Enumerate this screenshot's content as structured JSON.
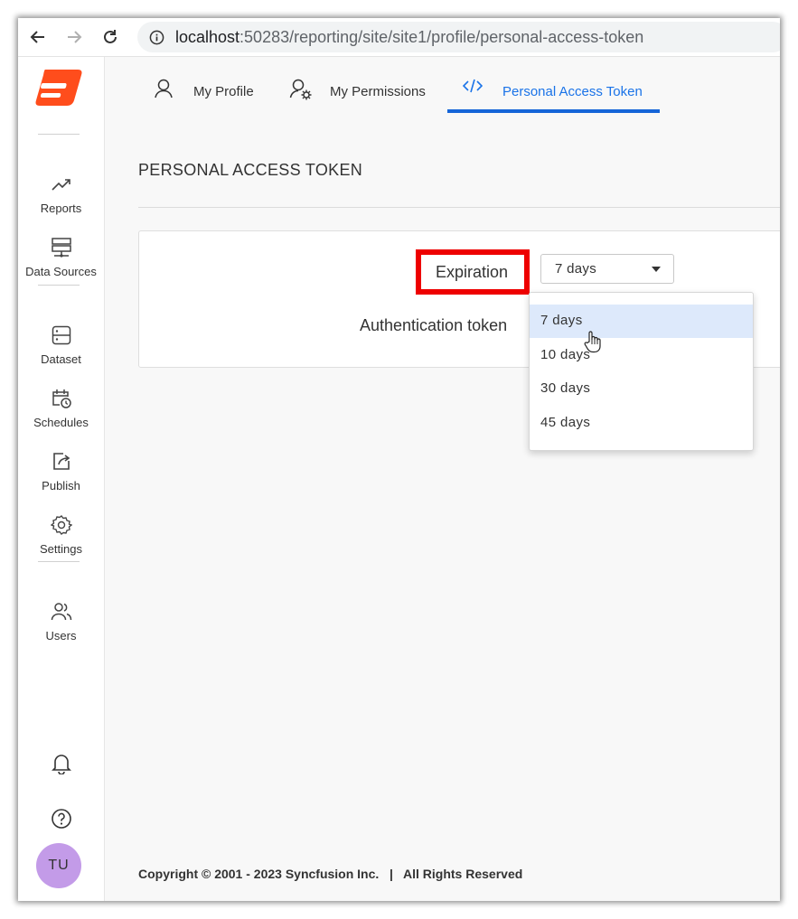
{
  "browser": {
    "url_host": "localhost",
    "url_rest": ":50283/reporting/site/site1/profile/personal-access-token",
    "icons": [
      "back-arrow-icon",
      "forward-arrow-icon",
      "reload-icon",
      "info-icon"
    ]
  },
  "sidebar": {
    "items": [
      {
        "label": "Reports",
        "icon": "trend-chart-icon"
      },
      {
        "label": "Data Sources",
        "icon": "server-icon"
      },
      {
        "label": "Dataset",
        "icon": "dataset-icon"
      },
      {
        "label": "Schedules",
        "icon": "calendar-clock-icon"
      },
      {
        "label": "Publish",
        "icon": "publish-icon"
      },
      {
        "label": "Settings",
        "icon": "gear-icon"
      },
      {
        "label": "Users",
        "icon": "users-icon"
      }
    ],
    "bottom_icons": [
      "bell-icon",
      "help-icon"
    ],
    "avatar": "TU",
    "logo_color": "#ff4d1c"
  },
  "tabs": [
    {
      "label": "My Profile",
      "icon": "user-icon"
    },
    {
      "label": "My Permissions",
      "icon": "user-settings-icon"
    },
    {
      "label": "Personal Access Token",
      "icon": "code-icon",
      "active": true
    }
  ],
  "page": {
    "title": "PERSONAL ACCESS TOKEN",
    "expiration_label": "Expiration",
    "auth_token_label": "Authentication token",
    "expiration_value": "7 days",
    "options": [
      "7 days",
      "10 days",
      "30 days",
      "45 days"
    ]
  },
  "footer": {
    "text": "Copyright © 2001 - 2023 Syncfusion Inc.   |   All Rights Reserved"
  },
  "colors": {
    "accent": "#1565d8",
    "highlight_box": "#ee0000",
    "selected_option": "#dde9fb",
    "avatar": "#c39be8"
  }
}
